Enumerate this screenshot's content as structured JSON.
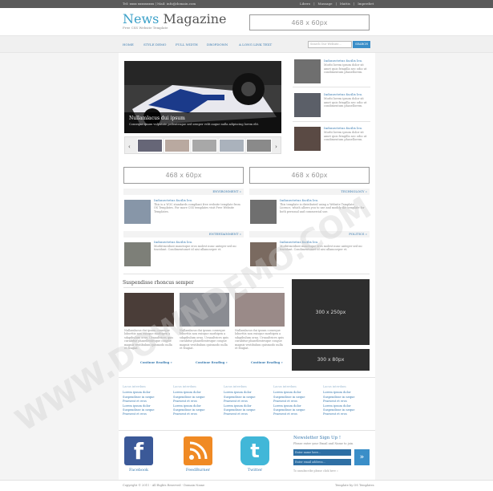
{
  "topbar": {
    "contact": "Tel: xxxx xxxxxxxxx | Mail: info@domain.com",
    "links": [
      "Libero",
      "Massage",
      "Mattis",
      "Imperdiet"
    ]
  },
  "header": {
    "logo_news": "News",
    "logo_magazine": "Magazine",
    "tagline": "Free CSS Website Template",
    "ad_label": "468 x 60px"
  },
  "nav": {
    "items": [
      "HOME",
      "STYLE DEMO",
      "FULL WIDTH",
      "DROPDOWN",
      "A LONG LINK TEXT"
    ],
    "search_placeholder": "Search Our Website...",
    "search_button": "SEARCH"
  },
  "slider": {
    "caption_title": "Nullamlacus dui ipsum",
    "caption_text": "Conseque ipsum vulputate pellentesque sed semper velit augue nulla adipiscing lorem elit."
  },
  "side_list": [
    {
      "title": "Indonectetus facilis leo.",
      "text": "Morbi lorem ipsum dolor sit amet quis fringilla nec odio ut condimentum phasellorem."
    },
    {
      "title": "Indonectetus facilis leo.",
      "text": "Morbi lorem ipsum dolor sit amet quis fringilla nec odio ut condimentum phasellorem."
    },
    {
      "title": "Indonectetus facilis leo.",
      "text": "Morbi lorem ipsum dolor sit amet quis fringilla nec odio ut condimentum phasellorem."
    }
  ],
  "ads": {
    "banner_left": "468 x 60px",
    "banner_right": "468 x 60px",
    "square": "300 x 250px",
    "small": "300 x 80px"
  },
  "sections": {
    "environment": "ENVIRONMENT »",
    "technology": "TECHNOLOGY »",
    "entertainment": "ENTERTAINMENT »",
    "politics": "POLITICS »"
  },
  "articles": [
    {
      "title": "Indonectetus facilis leo.",
      "text": "This is a W3C standards compliant free website template from OS Templates. For more CSS templates visit Free Website Templates."
    },
    {
      "title": "Indonectetus facilis leo.",
      "text": "This template is distributed using a Website Template Licence, which allows you to use and modify the template for both personal and commercial use."
    },
    {
      "title": "Indonectetus facilis leo.",
      "text": "Morbitincidunt maurisque eros molest nunc anteger sed mi tincidunt. Condimentumet id nisi ullamcorper et."
    },
    {
      "title": "Indonectetus facilis leo.",
      "text": "Morbitincidunt maurisque eros molest nunc anteger sed mi tincidunt. Condimentumet id nisi ullamcorper et."
    }
  ],
  "featured": {
    "title": "Suspendisse rhoncus semper",
    "columns": [
      {
        "text": "Nullamlacus dui ipsum conseque loborttis non euisque morbipen a sdapibulum orna. Urnaultrices quis curabitur phasellentesque congue magnis vestibulum quismodo nulla et feugiat.",
        "more": "Continue Reading »"
      },
      {
        "text": "Nullamlacus dui ipsum conseque loborttis non euisque morbipen a sdapibulum orna. Urnaultrices quis curabitur phasellentesque congue magnis vestibulum quismodo nulla et feugiat.",
        "more": "Continue Reading »"
      },
      {
        "text": "Nullamlacus dui ipsum conseque loborttis non euisque morbipen a sdapibulum orna. Urnaultrices quis curabitur phasellentesque congue magnis vestibulum quismodo nulla et feugiat.",
        "more": "Continue Reading »"
      }
    ]
  },
  "footer_links": [
    {
      "heading": "Lacus interdum",
      "items": [
        "Lorem ipsum dolor",
        "Suspendisse in neque",
        "Praesent et eros",
        "Lorem ipsum dolor",
        "Suspendisse in neque",
        "Praesent et eros"
      ]
    },
    {
      "heading": "Lacus interdum",
      "items": [
        "Lorem ipsum dolor",
        "Suspendisse in neque",
        "Praesent et eros",
        "Lorem ipsum dolor",
        "Suspendisse in neque",
        "Praesent et eros"
      ]
    },
    {
      "heading": "Lacus interdum",
      "items": [
        "Lorem ipsum dolor",
        "Suspendisse in neque",
        "Praesent et eros",
        "Lorem ipsum dolor",
        "Suspendisse in neque",
        "Praesent et eros"
      ]
    },
    {
      "heading": "Lacus interdum",
      "items": [
        "Lorem ipsum dolor",
        "Suspendisse in neque",
        "Praesent et eros",
        "Lorem ipsum dolor",
        "Suspendisse in neque",
        "Praesent et eros"
      ]
    },
    {
      "heading": "Lacus interdum",
      "items": [
        "Lorem ipsum dolor",
        "Suspendisse in neque",
        "Praesent et eros",
        "Lorem ipsum dolor",
        "Suspendisse in neque",
        "Praesent et eros"
      ]
    }
  ],
  "social": {
    "facebook": "Facebook",
    "feedburner": "FeedBurner",
    "twitter": "Twitter",
    "facebook_glyph": "f",
    "twitter_glyph": "t"
  },
  "newsletter": {
    "heading": "Newsletter Sign Up !",
    "subtext": "Please enter your Email and Name to join.",
    "name_placeholder": "Enter name here...",
    "email_placeholder": "Enter email address...",
    "go_glyph": "»",
    "unsubscribe": "To unsubscribe please click here »"
  },
  "footer": {
    "copyright": "Copyright © 2011 - All Rights Reserved - Domain Name",
    "credit": "Template by OS Templates"
  },
  "watermark": "WWW.DOWNDEMO.COM",
  "colors": {
    "accent": "#3a7bb0",
    "logo": "#3aa0c8",
    "topbar": "#5a5a5a",
    "dark_ad": "#2e2e2e"
  }
}
